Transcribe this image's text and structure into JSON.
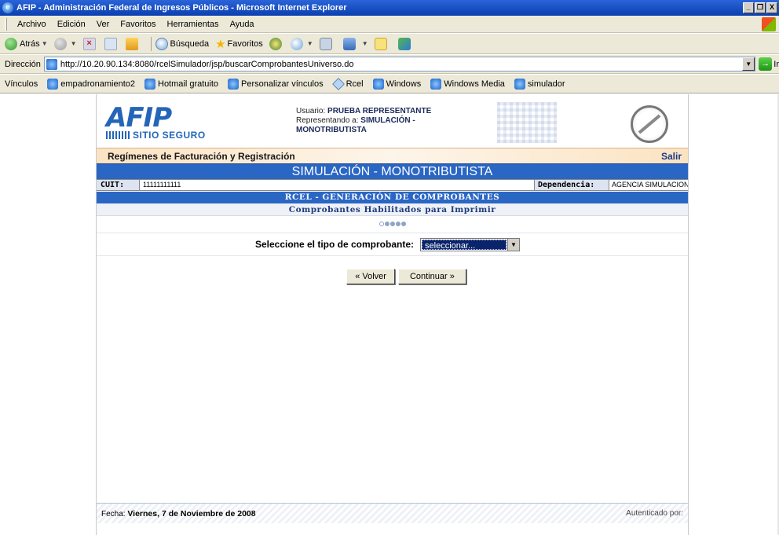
{
  "window": {
    "title": "AFIP - Administración Federal de Ingresos Públicos - Microsoft Internet Explorer",
    "minimize": "_",
    "restore": "̆",
    "close": "X"
  },
  "menubar": [
    "Archivo",
    "Edición",
    "Ver",
    "Favoritos",
    "Herramientas",
    "Ayuda"
  ],
  "toolbar": {
    "back_label": "Atrás",
    "search_label": "Búsqueda",
    "favorites_label": "Favoritos"
  },
  "address": {
    "label": "Dirección",
    "url": "http://10.20.90.134:8080/rcelSimulador/jsp/buscarComprobantesUniverso.do",
    "go_label": "Ir"
  },
  "links": {
    "label": "Vínculos",
    "items": [
      "empadronamiento2",
      "Hotmail gratuito",
      "Personalizar vínculos",
      "Rcel",
      "Windows",
      "Windows Media",
      "simulador"
    ]
  },
  "header": {
    "logo_text": "AFIP",
    "logo_sub": "SITIO SEGURO",
    "user_label": "Usuario:",
    "user_name": "PRUEBA REPRESENTANTE",
    "representing_label": "Representando a:",
    "representing_name": "SIMULACIÓN -",
    "representing_name_2": "MONOTRIBUTISTA"
  },
  "nav": {
    "section": "Regímenes de Facturación y Registración",
    "logout": "Salir"
  },
  "page_title": "SIMULACIÓN - MONOTRIBUTISTA",
  "cuit": {
    "label": "CUIT:",
    "value": "11111111111",
    "dependencia_label": "Dependencia:",
    "dependencia_value": "AGENCIA SIMULACION"
  },
  "section_title": "RCEL - GENERACIÓN DE COMPROBANTES",
  "section_subtitle": "Comprobantes Habilitados para Imprimir",
  "steps": {
    "total": 5,
    "current": 1
  },
  "form": {
    "label": "Seleccione el tipo de comprobante:",
    "select_value": "seleccionar..."
  },
  "buttons": {
    "back": "« Volver",
    "continue": "Continuar »"
  },
  "footer": {
    "date_label": "Fecha:",
    "date_value": "Viernes, 7 de Noviembre de 2008",
    "auth_label": "Autenticado por:"
  },
  "colors": {
    "title_band": "#2a66c4",
    "nav_band": "#fbe3c2",
    "select_highlight": "#0a246a"
  }
}
